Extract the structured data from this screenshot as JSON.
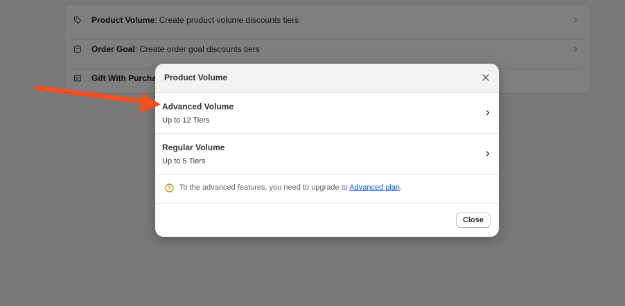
{
  "background_list": {
    "items": [
      {
        "title": "Product Volume",
        "desc": ": Create product volume discounts tiers",
        "icon": "tag-icon"
      },
      {
        "title": "Order Goal",
        "desc": ": Create order goal discounts tiers",
        "icon": "bag-icon"
      },
      {
        "title": "Gift With Purcha",
        "desc": "",
        "icon": "gift-icon"
      }
    ]
  },
  "modal": {
    "title": "Product Volume",
    "options": [
      {
        "title": "Advanced Volume",
        "subtitle": "Up to 12 Tiers"
      },
      {
        "title": "Regular Volume",
        "subtitle": "Up to 5 Tiers"
      }
    ],
    "notice": {
      "text": "To the advanced features, you need to upgrade to ",
      "link": "Advanced plan",
      "suffix": "."
    },
    "close_label": "Close"
  },
  "colors": {
    "annotation_arrow": "#f04e23",
    "link": "#005bd3",
    "notice_icon": "#b98900"
  }
}
